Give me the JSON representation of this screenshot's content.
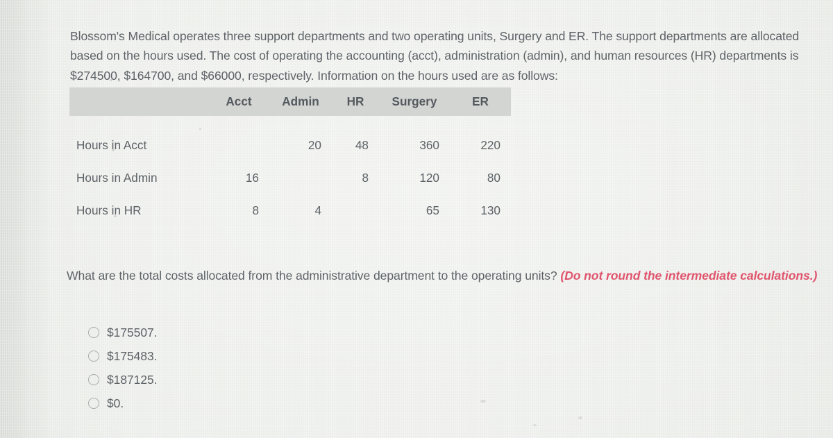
{
  "prompt": "Blossom's Medical operates three support departments and two operating units, Surgery and ER. The support departments are allocated based on the hours used. The cost of operating the accounting (acct), administration (admin), and human resources (HR) departments is $274500, $164700, and $66000, respectively. Information on the hours used are as follows:",
  "table": {
    "corner_header": "",
    "headers": [
      "Acct",
      "Admin",
      "HR",
      "Surgery",
      "ER"
    ],
    "rows": [
      {
        "label": "Hours in Acct",
        "values": [
          "",
          "20",
          "48",
          "360",
          "220"
        ]
      },
      {
        "label": "Hours in Admin",
        "values": [
          "16",
          "",
          "8",
          "120",
          "80"
        ]
      },
      {
        "label": "Hours in HR",
        "values": [
          "8",
          "4",
          "",
          "65",
          "130"
        ]
      }
    ]
  },
  "question": {
    "text": "What are the total costs allocated from the administrative department to the operating units? ",
    "hint": "(Do not round the intermediate calculations.)"
  },
  "choices": [
    {
      "label": "$175507."
    },
    {
      "label": "$175483."
    },
    {
      "label": "$187125."
    },
    {
      "label": "$0."
    }
  ],
  "colors": {
    "background": "#eceeea",
    "text": "#5e6368",
    "header_band": "#d3d5d3",
    "hint": "#e0556d",
    "radio_outline": "#a7abac"
  }
}
